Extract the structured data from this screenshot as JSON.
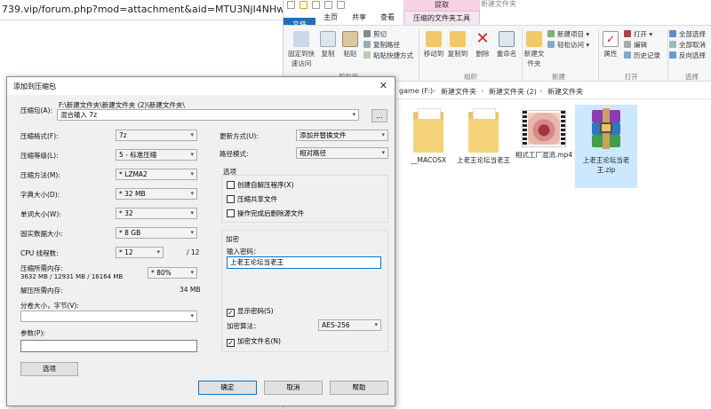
{
  "browser": {
    "url": "739.vip/forum.php?mod=attachment&aid=MTU3NjI4NHw1MmE0YjhjM"
  },
  "explorer": {
    "title": "新建文件夹",
    "context_tab_top": "提取",
    "tabs": {
      "file": "文件",
      "home": "主页",
      "share": "共享",
      "view": "查看",
      "tool": "压缩的文件夹工具"
    },
    "ribbon": {
      "pin": "固定到快速访问",
      "copy": "复制",
      "paste": "粘贴",
      "cut": "剪切",
      "copy_path": "复制路径",
      "paste_shortcut": "粘贴快捷方式",
      "move_to": "移动到",
      "copy_to": "复制到",
      "delete": "删除",
      "rename": "重命名",
      "new_folder": "新建文件夹",
      "new_item": "新建项目",
      "easy_access": "轻松访问",
      "properties": "属性",
      "open": "打开",
      "edit": "编辑",
      "history": "历史记录",
      "select_all": "全部选择",
      "select_none": "全部取消",
      "invert": "反向选择",
      "groups": {
        "clipboard": "剪贴板",
        "organize": "组织",
        "new": "新建",
        "open": "打开",
        "select": "选择"
      }
    },
    "breadcrumb": [
      "game (F:)",
      "新建文件夹",
      "新建文件夹 (2)",
      "新建文件夹"
    ],
    "files": [
      {
        "name": "__MACOSX"
      },
      {
        "name": "上老王论坛当老王"
      },
      {
        "name": "相式工厂混流.mp4"
      },
      {
        "name": "上老王论坛当老王.zip"
      }
    ]
  },
  "dialog": {
    "title": "添加到压缩包",
    "archive_label": "压缩包(A):",
    "archive_path": "F:\\新建文件夹\\新建文件夹 (2)\\新建文件夹\\",
    "archive_name": "混合输入 7z",
    "browse": "...",
    "format_label": "压缩格式(F):",
    "format": "7z",
    "level_label": "压缩等级(L):",
    "level": "5 - 标准压缩",
    "method_label": "压缩方法(M):",
    "method": "* LZMA2",
    "dict_label": "字典大小(D):",
    "dict": "* 32 MB",
    "word_label": "单词大小(W):",
    "word": "* 32",
    "solid_label": "固实数据大小:",
    "solid": "* 8 GB",
    "cpu_label": "CPU 线程数:",
    "cpu": "* 12",
    "cpu_total": "/ 12",
    "mem_comp_label": "压缩所需内存:",
    "mem_comp": "3632 MB / 12931 MB / 16164 MB",
    "mem_pct": "* 80%",
    "mem_decomp_label": "解压所需内存:",
    "mem_decomp": "34 MB",
    "split_label": "分卷大小，字节(V):",
    "params_label": "参数(P):",
    "options_btn": "选项",
    "update_label": "更新方式(U):",
    "update": "添加并替换文件",
    "path_label": "路径模式:",
    "path": "相对路径",
    "options_title": "选项",
    "opt_sfx": "创建自解压程序(X)",
    "opt_shared": "压缩共享文件",
    "opt_delete": "操作完成后删除源文件",
    "enc_title": "加密",
    "pwd_label": "输入密码：",
    "pwd": "上老王论坛当老王",
    "show_pwd": "显示密码(S)",
    "enc_method_label": "加密算法：",
    "enc_method": "AES-256",
    "enc_names": "加密文件名(N)",
    "ok": "确定",
    "cancel": "取消",
    "help": "帮助"
  }
}
